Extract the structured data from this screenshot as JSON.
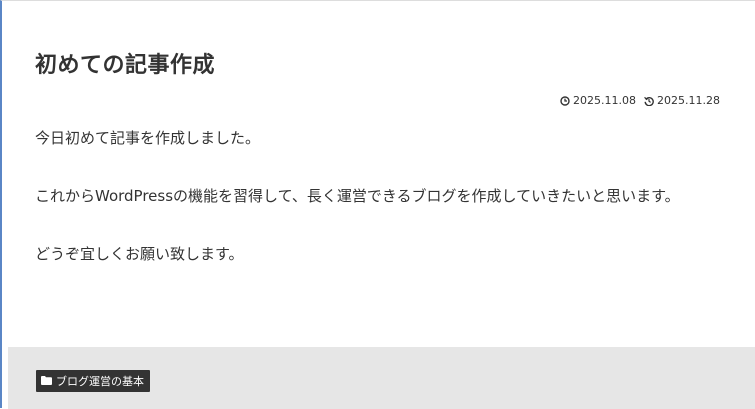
{
  "article": {
    "title": "初めての記事作成",
    "meta": {
      "published_date": "2025.11.08",
      "updated_date": "2025.11.28",
      "published_icon": "clock-icon",
      "updated_icon": "history-icon"
    },
    "paragraphs": [
      "今日初めて記事を作成しました。",
      "これからWordPressの機能を習得して、長く運営できるブログを作成していきたいと思います。",
      "どうぞ宜しくお願い致します。"
    ]
  },
  "footer": {
    "category": {
      "label": "ブログ運営の基本",
      "icon": "folder-icon"
    }
  },
  "colors": {
    "text": "#333333",
    "footer_background": "#e6e6e6",
    "tag_background": "#333333",
    "tag_text": "#ffffff",
    "accent_border": "#5a86c6"
  }
}
